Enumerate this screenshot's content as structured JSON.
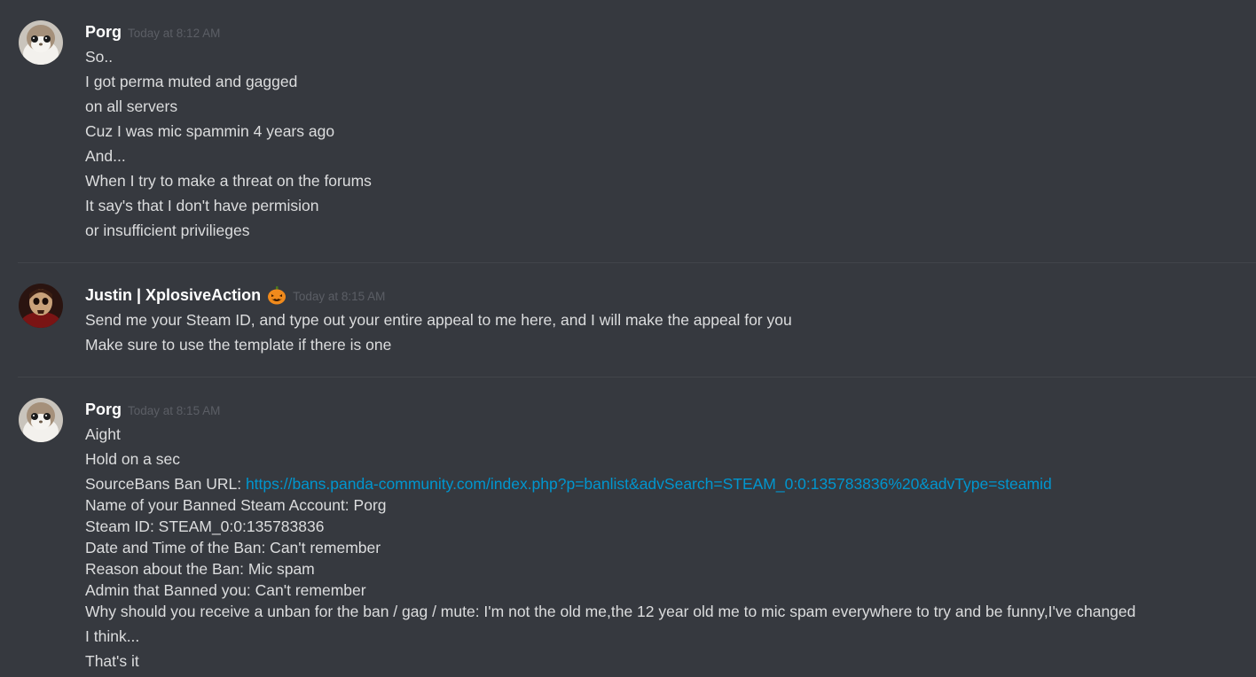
{
  "messages": [
    {
      "username": "Porg",
      "timestamp": "Today at 8:12 AM",
      "lines": [
        "So..",
        "I got perma muted and gagged",
        "on all servers",
        "Cuz I was mic spammin 4 years ago",
        "And...",
        "When I try to make a threat on the forums",
        "It say's that I don't have permision",
        "or insufficient privilieges"
      ]
    },
    {
      "username": "Justin | XplosiveAction",
      "badge_icon": "jack-o-lantern-icon",
      "timestamp": "Today at 8:15 AM",
      "lines": [
        "Send me your Steam ID, and type out your entire appeal to me here, and I will make the appeal for you",
        "Make sure to use the template if there is one"
      ]
    },
    {
      "username": "Porg",
      "timestamp": "Today at 8:15 AM",
      "lines": [
        "Aight",
        "Hold on a sec"
      ],
      "appeal": {
        "url_label": "SourceBans Ban URL: ",
        "url": "https://bans.panda-community.com/index.php?p=banlist&advSearch=STEAM_0:0:135783836%20&advType=steamid",
        "fields": [
          "Name of your Banned Steam Account: Porg",
          "Steam ID: STEAM_0:0:135783836",
          "Date and Time of the Ban: Can't remember",
          "Reason about the Ban: Mic spam",
          "Admin that Banned you: Can't remember",
          "Why should you receive a unban for the ban / gag / mute: I'm not the old me,the 12 year old me to mic spam everywhere to try and be funny,I've changed"
        ]
      },
      "after_lines": [
        "I think...",
        "That's it"
      ]
    }
  ],
  "colors": {
    "background": "#36393f",
    "username": "#ffffff",
    "text": "#dcddde",
    "timestamp": "#5b5e65",
    "link": "#0096cf",
    "divider": "#42454a"
  }
}
